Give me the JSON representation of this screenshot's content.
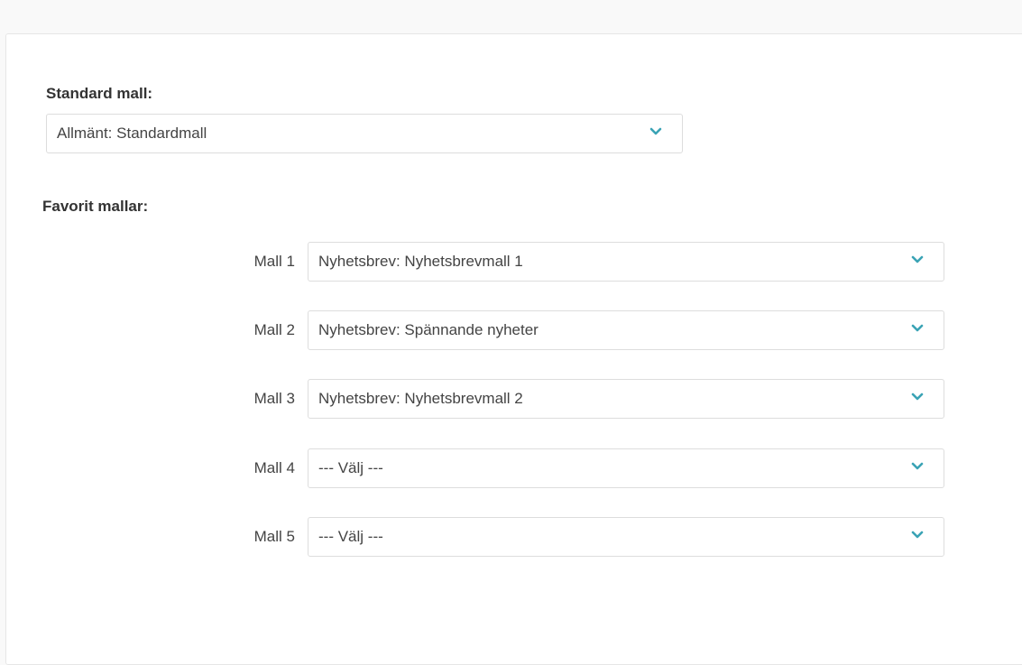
{
  "standard": {
    "label": "Standard mall:",
    "value": "Allmänt: Standardmall",
    "icon": "chevron-down-icon"
  },
  "favorites": {
    "label": "Favorit mallar:",
    "items": [
      {
        "label": "Mall 1",
        "value": "Nyhetsbrev: Nyhetsbrevmall 1"
      },
      {
        "label": "Mall 2",
        "value": "Nyhetsbrev: Spännande nyheter"
      },
      {
        "label": "Mall 3",
        "value": "Nyhetsbrev: Nyhetsbrevmall 2"
      },
      {
        "label": "Mall 4",
        "value": "--- Välj ---"
      },
      {
        "label": "Mall 5",
        "value": "--- Välj ---"
      }
    ]
  },
  "colors": {
    "accent": "#3aa3b5",
    "border": "#dddddd",
    "background": "#f9f9f9"
  }
}
